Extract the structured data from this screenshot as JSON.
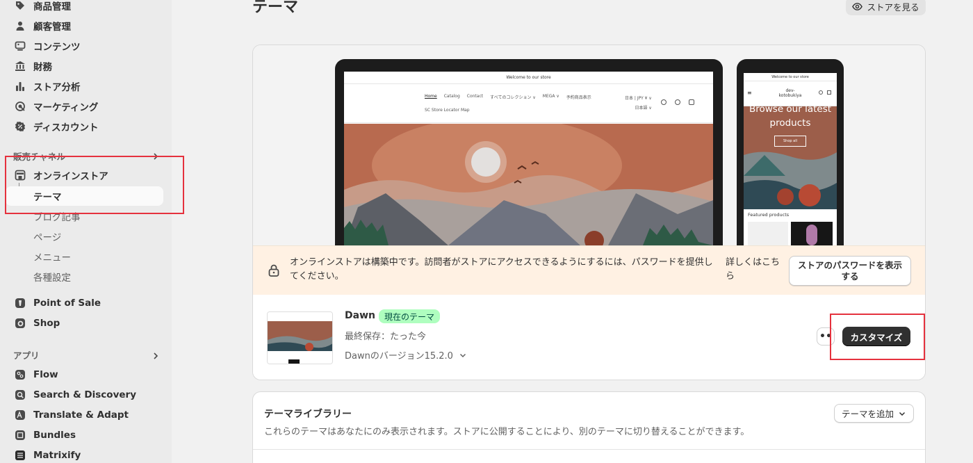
{
  "sidebar": {
    "top_items": [
      {
        "label": "商品管理",
        "icon": "tag-icon"
      },
      {
        "label": "顧客管理",
        "icon": "person-icon"
      },
      {
        "label": "コンテンツ",
        "icon": "content-icon"
      },
      {
        "label": "財務",
        "icon": "bank-icon"
      },
      {
        "label": "ストア分析",
        "icon": "chart-bar-icon"
      },
      {
        "label": "マーケティング",
        "icon": "target-icon"
      },
      {
        "label": "ディスカウント",
        "icon": "discount-icon"
      }
    ],
    "sales_channels": {
      "header": "販売チャネル",
      "online_store": "オンラインストア",
      "sub_items": [
        "テーマ",
        "ブログ記事",
        "ページ",
        "メニュー",
        "各種設定"
      ],
      "pos": "Point of Sale",
      "shop": "Shop"
    },
    "apps": {
      "header": "アプリ",
      "items": [
        "Flow",
        "Search & Discovery",
        "Translate & Adapt",
        "Bundles",
        "Matrixify"
      ]
    }
  },
  "page": {
    "title": "テーマ",
    "view_store": "ストアを見る"
  },
  "preview": {
    "desktop": {
      "announcement": "Welcome to our store",
      "nav_links": [
        "Home",
        "Catalog",
        "Contact",
        "すべてのコレクション ∨",
        "MEGA ∨",
        "予約商品表示"
      ],
      "nav_row2": "SC Store Locator Map",
      "locale": "日本 | JPY ¥ ∨",
      "language": "日本語 ∨"
    },
    "mobile": {
      "announcement": "Welcome to our store",
      "store_name_1": "dev-",
      "store_name_2": "kotobukiya",
      "hero_text": "Browse our latest products",
      "shop_all": "Shop all",
      "featured": "Featured products"
    }
  },
  "banner": {
    "message": "オンラインストアは構築中です。訪問者がストアにアクセスできるようにするには、パスワードを提供してください。",
    "learn_more": "詳しくはこちら",
    "password_button": "ストアのパスワードを表示する"
  },
  "current_theme": {
    "name": "Dawn",
    "badge": "現在のテーマ",
    "saved": "最終保存：たった今",
    "version": "Dawnのバージョン15.2.0",
    "more_label": "••",
    "customize": "カスタマイズ"
  },
  "library": {
    "title": "テーマライブラリー",
    "description": "これらのテーマはあなたにのみ表示されます。ストアに公開することにより、別のテーマに切り替えることができます。",
    "add_theme": "テーマを追加"
  },
  "colors": {
    "accent_highlight": "#e5313d",
    "badge_bg": "#affebf",
    "primary_button": "#303030",
    "banner_bg": "#fff1e3"
  }
}
